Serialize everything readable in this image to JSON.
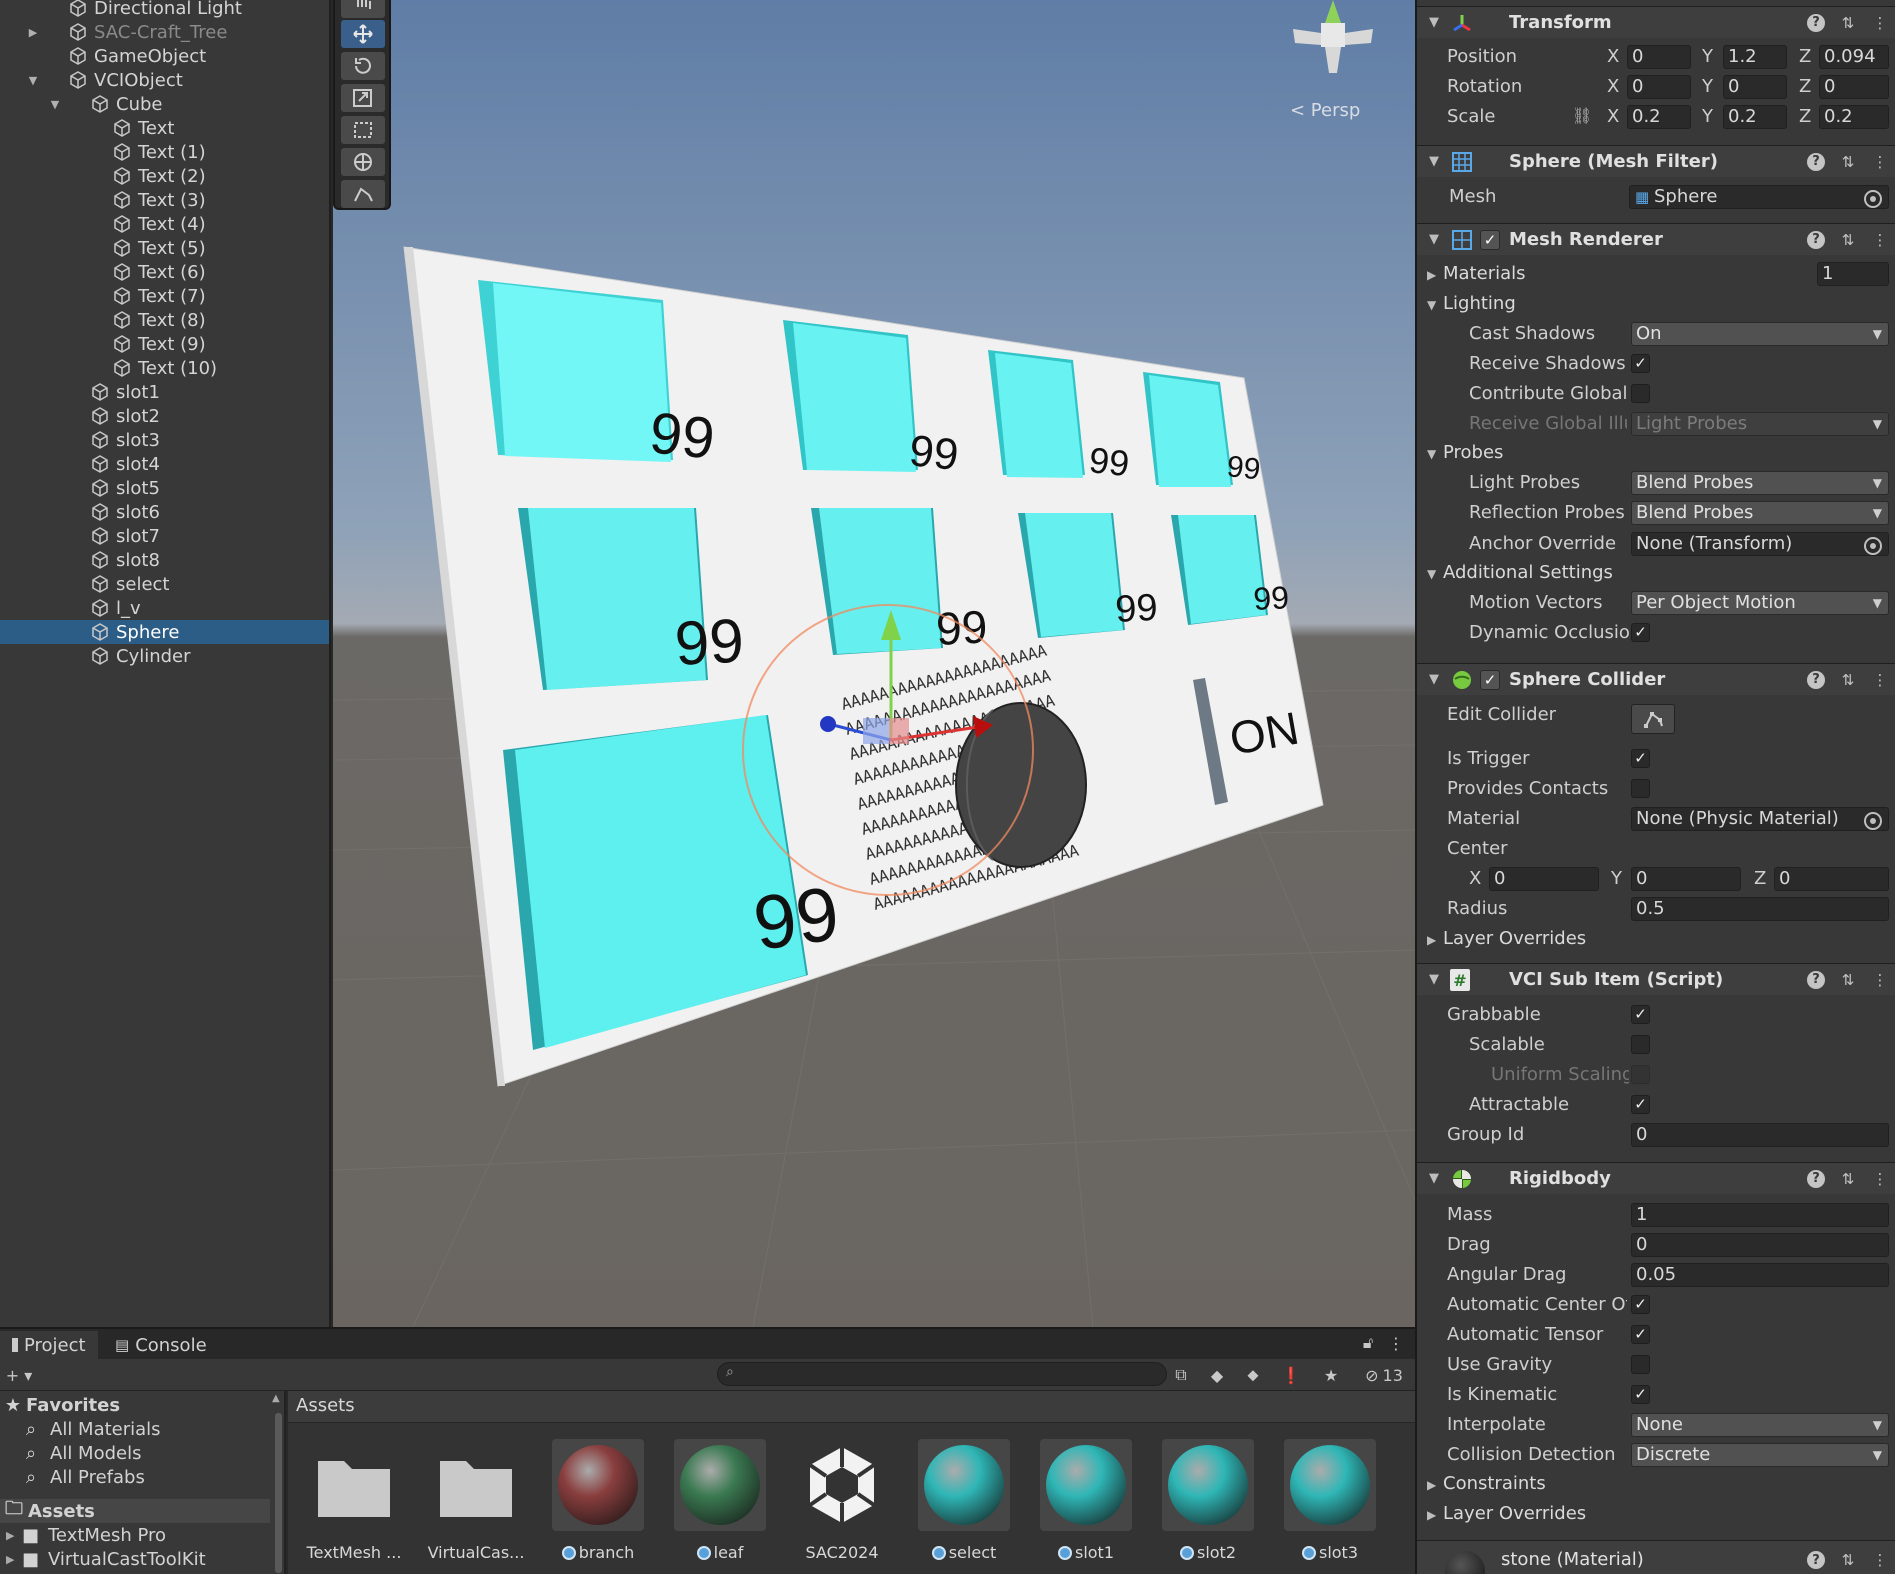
{
  "hierarchy": {
    "items": [
      {
        "label": "Directional Light",
        "indent": 1,
        "arrow": "",
        "dim": false,
        "selected": false
      },
      {
        "label": "SAC-Craft_Tree",
        "indent": 1,
        "arrow": "▶",
        "dim": true,
        "selected": false
      },
      {
        "label": "GameObject",
        "indent": 1,
        "arrow": "",
        "dim": false,
        "selected": false
      },
      {
        "label": "VCIObject",
        "indent": 1,
        "arrow": "▼",
        "dim": false,
        "selected": false
      },
      {
        "label": "Cube",
        "indent": 2,
        "arrow": "▼",
        "dim": false,
        "selected": false
      },
      {
        "label": "Text",
        "indent": 3,
        "arrow": "",
        "dim": false,
        "selected": false
      },
      {
        "label": "Text (1)",
        "indent": 3,
        "arrow": "",
        "dim": false,
        "selected": false
      },
      {
        "label": "Text (2)",
        "indent": 3,
        "arrow": "",
        "dim": false,
        "selected": false
      },
      {
        "label": "Text (3)",
        "indent": 3,
        "arrow": "",
        "dim": false,
        "selected": false
      },
      {
        "label": "Text (4)",
        "indent": 3,
        "arrow": "",
        "dim": false,
        "selected": false
      },
      {
        "label": "Text (5)",
        "indent": 3,
        "arrow": "",
        "dim": false,
        "selected": false
      },
      {
        "label": "Text (6)",
        "indent": 3,
        "arrow": "",
        "dim": false,
        "selected": false
      },
      {
        "label": "Text (7)",
        "indent": 3,
        "arrow": "",
        "dim": false,
        "selected": false
      },
      {
        "label": "Text (8)",
        "indent": 3,
        "arrow": "",
        "dim": false,
        "selected": false
      },
      {
        "label": "Text (9)",
        "indent": 3,
        "arrow": "",
        "dim": false,
        "selected": false
      },
      {
        "label": "Text (10)",
        "indent": 3,
        "arrow": "",
        "dim": false,
        "selected": false
      },
      {
        "label": "slot1",
        "indent": 2,
        "arrow": "",
        "dim": false,
        "selected": false
      },
      {
        "label": "slot2",
        "indent": 2,
        "arrow": "",
        "dim": false,
        "selected": false
      },
      {
        "label": "slot3",
        "indent": 2,
        "arrow": "",
        "dim": false,
        "selected": false
      },
      {
        "label": "slot4",
        "indent": 2,
        "arrow": "",
        "dim": false,
        "selected": false
      },
      {
        "label": "slot5",
        "indent": 2,
        "arrow": "",
        "dim": false,
        "selected": false
      },
      {
        "label": "slot6",
        "indent": 2,
        "arrow": "",
        "dim": false,
        "selected": false
      },
      {
        "label": "slot7",
        "indent": 2,
        "arrow": "",
        "dim": false,
        "selected": false
      },
      {
        "label": "slot8",
        "indent": 2,
        "arrow": "",
        "dim": false,
        "selected": false
      },
      {
        "label": "select",
        "indent": 2,
        "arrow": "",
        "dim": false,
        "selected": false
      },
      {
        "label": "l_v",
        "indent": 2,
        "arrow": "",
        "dim": false,
        "selected": false
      },
      {
        "label": "Sphere",
        "indent": 2,
        "arrow": "",
        "dim": false,
        "selected": true
      },
      {
        "label": "Cylinder",
        "indent": 2,
        "arrow": "",
        "dim": false,
        "selected": false
      }
    ]
  },
  "scene": {
    "persp_label": "< Persp",
    "slot_numbers": [
      "99",
      "99",
      "99",
      "99",
      "99",
      "99",
      "99",
      "99",
      "99"
    ],
    "on_label": "ON",
    "text_rows": "AAAAAAAAAAAAAAAAAAAAAA",
    "colors": {
      "slot": "#5ff2f0",
      "slot_side": "#2aa7ad",
      "board": "#f1f1f1"
    }
  },
  "inspector": {
    "transform": {
      "title": "Transform",
      "position_label": "Position",
      "position": {
        "x": "0",
        "y": "1.2",
        "z": "0.094"
      },
      "rotation_label": "Rotation",
      "rotation": {
        "x": "0",
        "y": "0",
        "z": "0"
      },
      "scale_label": "Scale",
      "scale": {
        "x": "0.2",
        "y": "0.2",
        "z": "0.2"
      }
    },
    "mesh_filter": {
      "title": "Sphere (Mesh Filter)",
      "mesh_label": "Mesh",
      "mesh_value": "Sphere"
    },
    "mesh_renderer": {
      "title": "Mesh Renderer",
      "materials_label": "Materials",
      "materials_count": "1",
      "lighting_label": "Lighting",
      "cast_shadows_label": "Cast Shadows",
      "cast_shadows": "On",
      "receive_shadows_label": "Receive Shadows",
      "contribute_gi_label": "Contribute Global",
      "receive_gi_label": "Receive Global Illu",
      "receive_gi": "Light Probes",
      "probes_label": "Probes",
      "light_probes_label": "Light Probes",
      "light_probes": "Blend Probes",
      "reflection_probes_label": "Reflection Probes",
      "reflection_probes": "Blend Probes",
      "anchor_override_label": "Anchor Override",
      "anchor_override": "None (Transform)",
      "additional_label": "Additional Settings",
      "motion_vectors_label": "Motion Vectors",
      "motion_vectors": "Per Object Motion",
      "dynamic_occlusion_label": "Dynamic Occlusion"
    },
    "sphere_collider": {
      "title": "Sphere Collider",
      "edit_collider_label": "Edit Collider",
      "is_trigger_label": "Is Trigger",
      "provides_contacts_label": "Provides Contacts",
      "material_label": "Material",
      "material": "None (Physic Material)",
      "center_label": "Center",
      "center": {
        "x": "0",
        "y": "0",
        "z": "0"
      },
      "radius_label": "Radius",
      "radius": "0.5",
      "layer_overrides_label": "Layer Overrides"
    },
    "vci_sub_item": {
      "title": "VCI Sub Item (Script)",
      "grabbable_label": "Grabbable",
      "scalable_label": "Scalable",
      "uniform_scaling_label": "Uniform Scaling",
      "attractable_label": "Attractable",
      "group_id_label": "Group Id",
      "group_id": "0"
    },
    "rigidbody": {
      "title": "Rigidbody",
      "mass_label": "Mass",
      "mass": "1",
      "drag_label": "Drag",
      "drag": "0",
      "angular_drag_label": "Angular Drag",
      "angular_drag": "0.05",
      "auto_center_label": "Automatic Center Of",
      "auto_tensor_label": "Automatic Tensor",
      "use_gravity_label": "Use Gravity",
      "is_kinematic_label": "Is Kinematic",
      "interpolate_label": "Interpolate",
      "interpolate": "None",
      "collision_label": "Collision Detection",
      "collision": "Discrete",
      "constraints_label": "Constraints",
      "layer_overrides_label": "Layer Overrides"
    },
    "material": {
      "title": "stone (Material)"
    }
  },
  "project": {
    "tab_project": "Project",
    "tab_console": "Console",
    "hidden_count": "13",
    "favorites_label": "Favorites",
    "favorites": [
      "All Materials",
      "All Models",
      "All Prefabs"
    ],
    "assets_label": "Assets",
    "asset_folders": [
      "TextMesh Pro",
      "VirtualCastToolKit"
    ],
    "path_label": "Assets",
    "assets": [
      {
        "name": "TextMesh ...",
        "kind": "folder",
        "color": ""
      },
      {
        "name": "VirtualCas...",
        "kind": "folder",
        "color": ""
      },
      {
        "name": "branch",
        "kind": "material",
        "color": "#8a3e3e"
      },
      {
        "name": "leaf",
        "kind": "material",
        "color": "#3b7a52"
      },
      {
        "name": "SAC2024",
        "kind": "unity",
        "color": ""
      },
      {
        "name": "select",
        "kind": "material",
        "color": "#2fb6b6"
      },
      {
        "name": "slot1",
        "kind": "material",
        "color": "#2fb6b6"
      },
      {
        "name": "slot2",
        "kind": "material",
        "color": "#2fb6b6"
      },
      {
        "name": "slot3",
        "kind": "material",
        "color": "#2fb6b6"
      }
    ]
  }
}
